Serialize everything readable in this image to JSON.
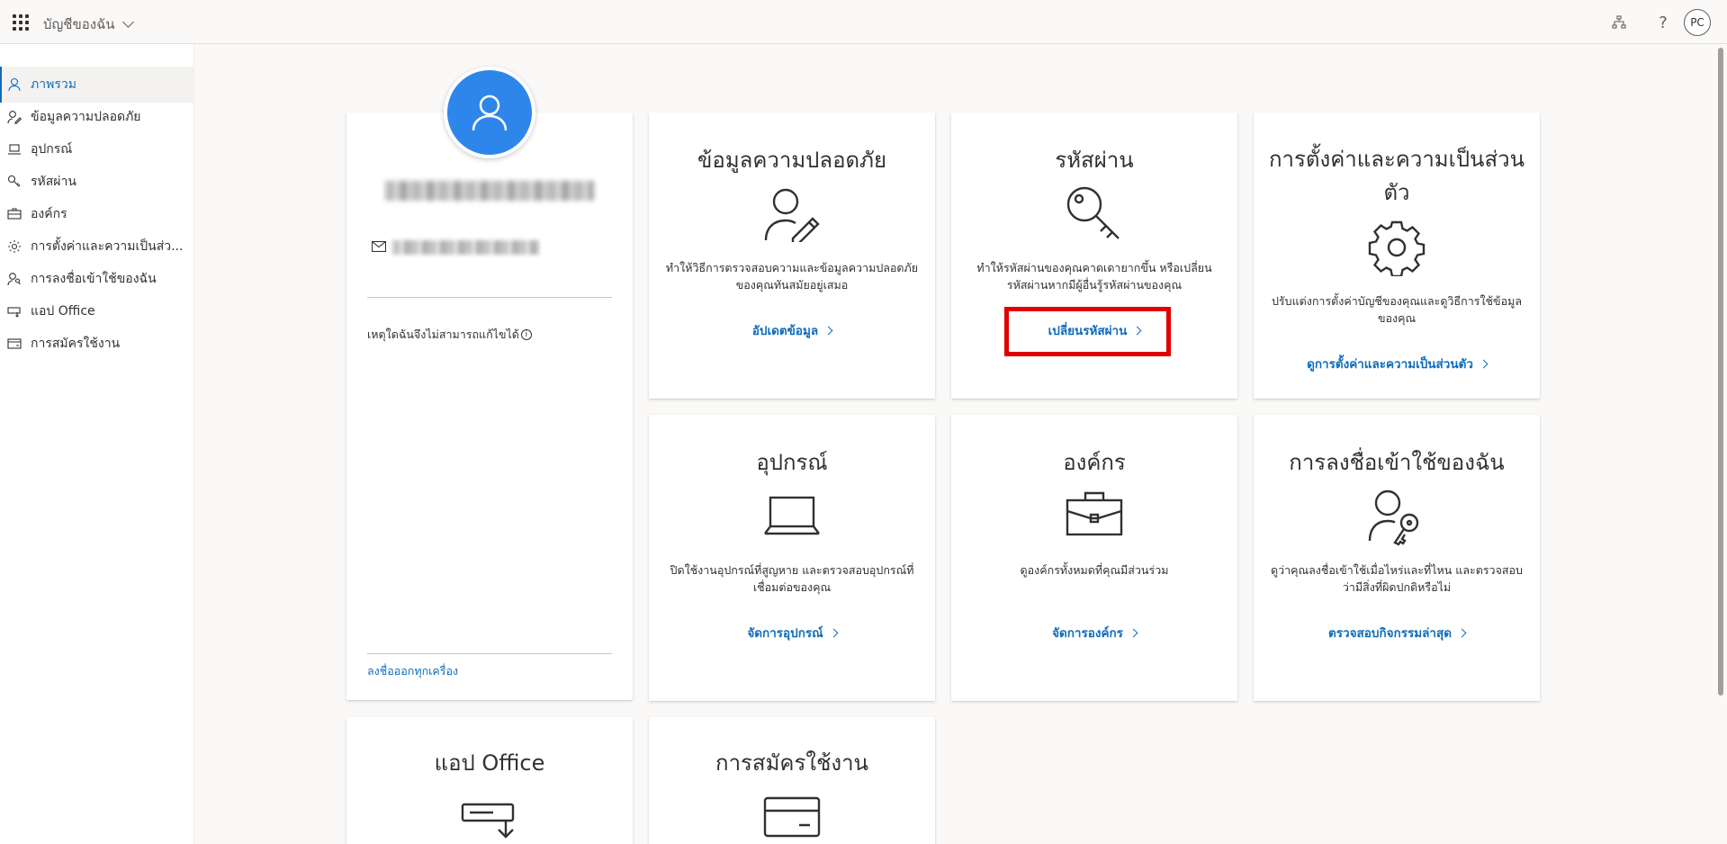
{
  "topbar": {
    "app_title": "บัญชีของฉัน",
    "avatar_initials": "PC",
    "help_label": "?"
  },
  "sidebar": {
    "items": [
      {
        "label": "ภาพรวม",
        "icon": "person-icon"
      },
      {
        "label": "ข้อมูลความปลอดภัย",
        "icon": "person-edit-icon"
      },
      {
        "label": "อุปกรณ์",
        "icon": "laptop-icon"
      },
      {
        "label": "รหัสผ่าน",
        "icon": "key-icon"
      },
      {
        "label": "องค์กร",
        "icon": "briefcase-icon"
      },
      {
        "label": "การตั้งค่าและความเป็นส่ว...",
        "icon": "gear-icon"
      },
      {
        "label": "การลงชื่อเข้าใช้ของฉัน",
        "icon": "person-key-icon"
      },
      {
        "label": "แอป Office",
        "icon": "office-app-icon"
      },
      {
        "label": "การสมัครใช้งาน",
        "icon": "card-icon"
      }
    ]
  },
  "profile": {
    "question": "เหตุใดฉันจึงไม่สามารถแก้ไขได้",
    "signout": "ลงชื่อออกทุกเครื่อง"
  },
  "cards": {
    "security": {
      "title": "ข้อมูลความปลอดภัย",
      "desc": "ทำให้วิธีการตรวจสอบความและข้อมูลความปลอดภัยของคุณทันสมัยอยู่เสมอ",
      "link": "อัปเดตข้อมูล"
    },
    "password": {
      "title": "รหัสผ่าน",
      "desc": "ทำให้รหัสผ่านของคุณคาดเดายากขึ้น หรือเปลี่ยนรหัสผ่านหากมีผู้อื่นรู้รหัสผ่านของคุณ",
      "link": "เปลี่ยนรหัสผ่าน"
    },
    "privacy": {
      "title": "การตั้งค่าและความเป็นส่วนตัว",
      "desc": "ปรับแต่งการตั้งค่าบัญชีของคุณและดูวิธีการใช้ข้อมูลของคุณ",
      "link": "ดูการตั้งค่าและความเป็นส่วนตัว"
    },
    "devices": {
      "title": "อุปกรณ์",
      "desc": "ปิดใช้งานอุปกรณ์ที่สูญหาย และตรวจสอบอุปกรณ์ที่เชื่อมต่อของคุณ",
      "link": "จัดการอุปกรณ์"
    },
    "organizations": {
      "title": "องค์กร",
      "desc": "ดูองค์กรทั้งหมดที่คุณมีส่วนร่วม",
      "link": "จัดการองค์กร"
    },
    "signins": {
      "title": "การลงชื่อเข้าใช้ของฉัน",
      "desc": "ดูว่าคุณลงชื่อเข้าใช้เมื่อไหร่และที่ไหน และตรวจสอบว่ามีสิ่งที่ผิดปกติหรือไม่",
      "link": "ตรวจสอบกิจกรรมล่าสุด"
    },
    "office": {
      "title": "แอป Office"
    },
    "subscriptions": {
      "title": "การสมัครใช้งาน"
    }
  },
  "colors": {
    "accent": "#0f6cbd",
    "avatar_bg": "#2f86ea",
    "highlight": "#e00000"
  }
}
